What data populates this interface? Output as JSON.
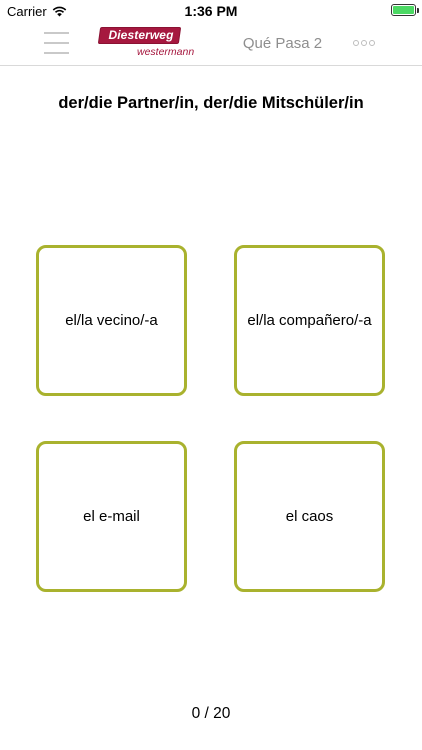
{
  "status_bar": {
    "carrier": "Carrier",
    "time": "1:36 PM",
    "wifi_icon": "wifi-icon",
    "battery_icon": "battery-icon",
    "battery_color": "#4cd964",
    "battery_level": 1.0
  },
  "nav": {
    "menu_icon": "hamburger-menu-icon",
    "logo_text": "Diesterweg",
    "logo_subtext": "westermann",
    "title": "Qué Pasa 2",
    "more_icon": "more-options-icon",
    "brand_color": "#a6183f"
  },
  "quiz": {
    "question": "der/die Partner/in, der/die Mitschüler/in",
    "answers": [
      "el/la vecino/-a",
      "el/la compañero/-a",
      "el e-mail",
      "el caos"
    ],
    "card_border_color": "#a9b22e",
    "progress": "0 / 20"
  }
}
